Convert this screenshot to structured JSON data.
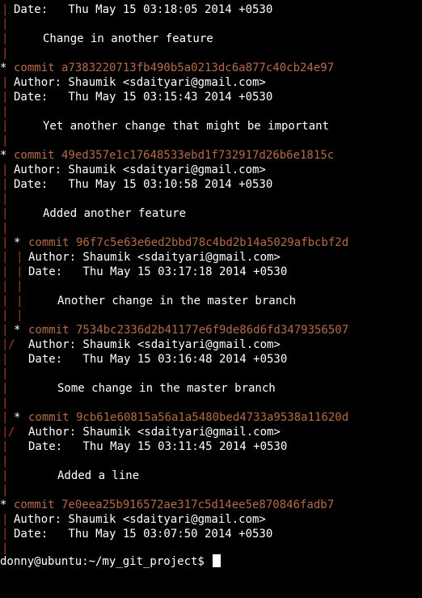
{
  "colors": {
    "background": "#000000",
    "text": "#ffffff",
    "graph": "#a83c28",
    "commit_hash": "#b56b46"
  },
  "log": {
    "top_date": "Date:   Thu May 15 03:18:05 2014 +0530",
    "top_message": "Change in another feature",
    "commits": [
      {
        "label": "commit a7383220713fb490b5a0213dc6a877c40cb24e97",
        "author": "Author: Shaumik <sdaityari@gmail.com>",
        "date": "Date:   Thu May 15 03:15:43 2014 +0530",
        "message": "Yet another change that might be important"
      },
      {
        "label": "commit 49ed357e1c17648533ebd1f732917d26b6e1815c",
        "author": "Author: Shaumik <sdaityari@gmail.com>",
        "date": "Date:   Thu May 15 03:10:58 2014 +0530",
        "message": "Added another feature"
      },
      {
        "label": "commit 96f7c5e63e6ed2bbd78c4bd2b14a5029afbcbf2d",
        "author": "Author: Shaumik <sdaityari@gmail.com>",
        "date": "Date:   Thu May 15 03:17:18 2014 +0530",
        "message": "Another change in the master branch"
      },
      {
        "label": "commit 7534bc2336d2b41177e6f9de86d6fd3479356507",
        "author": "Author: Shaumik <sdaityari@gmail.com>",
        "date": "Date:   Thu May 15 03:16:48 2014 +0530",
        "message": "Some change in the master branch"
      },
      {
        "label": "commit 9cb61e60815a56a1a5480bed4733a9538a11620d",
        "author": "Author: Shaumik <sdaityari@gmail.com>",
        "date": "Date:   Thu May 15 03:11:45 2014 +0530",
        "message": "Added a line"
      },
      {
        "label": "commit 7e0eea25b916572ae317c5d14ee5e870846fadb7",
        "author": "Author: Shaumik <sdaityari@gmail.com>",
        "date": "Date:   Thu May 15 03:07:50 2014 +0530"
      }
    ],
    "prompt": "donny@ubuntu:~/my_git_project$"
  }
}
